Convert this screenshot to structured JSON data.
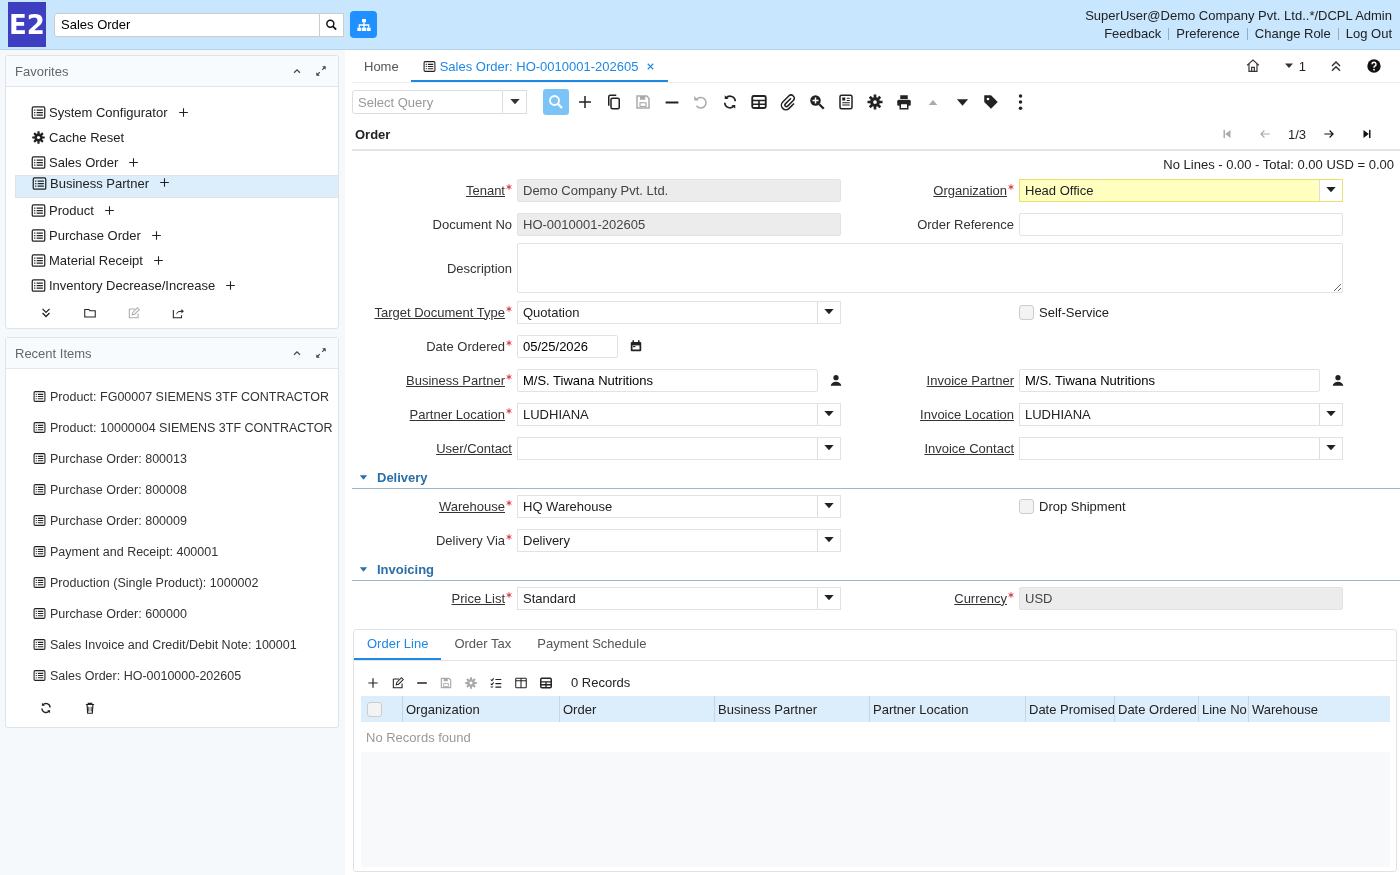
{
  "header": {
    "logo": "E2",
    "search": {
      "value": "Sales Order"
    },
    "user": "SuperUser@Demo Company Pvt. Ltd..*/DCPL Admin",
    "links": [
      "Feedback",
      "Preference",
      "Change Role",
      "Log Out"
    ]
  },
  "favorites": {
    "title": "Favorites",
    "items": [
      {
        "label": "System Configurator",
        "kind": "window",
        "addable": true,
        "selected": false
      },
      {
        "label": "Cache Reset",
        "kind": "process",
        "addable": false,
        "selected": false
      },
      {
        "label": "Sales Order",
        "kind": "window",
        "addable": true,
        "selected": false
      },
      {
        "label": "Business Partner",
        "kind": "window",
        "addable": true,
        "selected": true
      },
      {
        "label": "Product",
        "kind": "window",
        "addable": true,
        "selected": false
      },
      {
        "label": "Purchase Order",
        "kind": "window",
        "addable": true,
        "selected": false
      },
      {
        "label": "Material Receipt",
        "kind": "window",
        "addable": true,
        "selected": false
      },
      {
        "label": "Inventory Decrease/Increase",
        "kind": "window",
        "addable": true,
        "selected": false
      }
    ],
    "actions": [
      {
        "kind": "expand",
        "disabled": false
      },
      {
        "kind": "folder",
        "disabled": false
      },
      {
        "kind": "edit",
        "disabled": true
      },
      {
        "kind": "share",
        "disabled": false
      }
    ]
  },
  "recent": {
    "title": "Recent Items",
    "items": [
      "Product: FG00007 SIEMENS 3TF CONTRACTOR",
      "Product: 10000004 SIEMENS 3TF CONTRACTOR",
      "Purchase Order: 800013",
      "Purchase Order: 800008",
      "Purchase Order: 800009",
      "Payment and Receipt: 400001",
      "Production (Single Product): 1000002",
      "Purchase Order: 600000",
      "Sales Invoice and Credit/Debit Note: 100001",
      "Sales Order: HO-0010000-202605"
    ],
    "actions": [
      {
        "kind": "refresh",
        "disabled": false
      },
      {
        "kind": "trash",
        "disabled": false
      }
    ]
  },
  "tabs": [
    {
      "label": "Home",
      "selected": false,
      "closable": false
    },
    {
      "label": "Sales Order: HO-0010001-202605",
      "selected": true,
      "closable": true
    }
  ],
  "window_actions": {
    "badge": "1"
  },
  "toolbar": {
    "query_placeholder": "Select Query",
    "buttons": [
      {
        "kind": "search",
        "disabled": false,
        "active": true
      },
      {
        "kind": "plus",
        "disabled": false,
        "active": false
      },
      {
        "kind": "copy",
        "disabled": false,
        "active": false
      },
      {
        "kind": "save",
        "disabled": true,
        "active": false
      },
      {
        "kind": "minus",
        "disabled": false,
        "active": false
      },
      {
        "kind": "undo",
        "disabled": true,
        "active": false
      },
      {
        "kind": "refresh",
        "disabled": false,
        "active": false
      },
      {
        "kind": "grid",
        "disabled": false,
        "active": false
      },
      {
        "kind": "paperclip",
        "disabled": false,
        "active": false
      },
      {
        "kind": "zoom",
        "disabled": false,
        "active": false
      },
      {
        "kind": "report",
        "disabled": false,
        "active": false
      },
      {
        "kind": "gear",
        "disabled": false,
        "active": false
      },
      {
        "kind": "printer",
        "disabled": false,
        "active": false
      },
      {
        "kind": "up",
        "disabled": true,
        "active": false
      },
      {
        "kind": "down",
        "disabled": false,
        "active": false
      },
      {
        "kind": "tag",
        "disabled": false,
        "active": false
      },
      {
        "kind": "more",
        "disabled": false,
        "active": false
      }
    ]
  },
  "form": {
    "title": "Order",
    "record": "1/3",
    "nav": [
      {
        "kind": "first",
        "disabled": true
      },
      {
        "kind": "prev",
        "disabled": true
      },
      {
        "kind": "next",
        "disabled": false
      },
      {
        "kind": "last",
        "disabled": false
      }
    ],
    "summary": "No Lines - 0.00 - Total: 0.00 USD = 0.00",
    "groups": [
      {
        "rows": [
          [
            {
              "label": "Tenant",
              "link": true,
              "mandatory": true,
              "kind": "readonly",
              "value": "Demo Company Pvt. Ltd."
            },
            {
              "label": "Organization",
              "link": true,
              "mandatory": true,
              "kind": "select",
              "value": "Head Office",
              "focused": true
            }
          ],
          [
            {
              "label": "Document No",
              "link": false,
              "mandatory": false,
              "kind": "readonly",
              "value": "HO-0010001-202605"
            },
            {
              "label": "Order Reference",
              "link": false,
              "mandatory": false,
              "kind": "text"
            }
          ],
          [
            {
              "label": "Description",
              "link": false,
              "mandatory": false,
              "kind": "textarea"
            }
          ],
          [
            {
              "label": "Target Document Type",
              "link": true,
              "mandatory": true,
              "kind": "select",
              "value": "Quotation"
            },
            {
              "label": "Self-Service",
              "kind": "checkbox",
              "checked": false
            }
          ],
          [
            {
              "label": "Date Ordered",
              "link": false,
              "mandatory": true,
              "kind": "date",
              "value": "05/25/2026"
            }
          ],
          [
            {
              "label": "Business Partner",
              "link": true,
              "mandatory": true,
              "kind": "search",
              "value": "M/S. Tiwana Nutritions"
            },
            {
              "label": "Invoice Partner",
              "link": true,
              "mandatory": false,
              "kind": "search",
              "value": "M/S. Tiwana Nutritions"
            }
          ],
          [
            {
              "label": "Partner Location",
              "link": true,
              "mandatory": true,
              "kind": "select",
              "value": "LUDHIANA"
            },
            {
              "label": "Invoice Location",
              "link": true,
              "mandatory": false,
              "kind": "select",
              "value": "LUDHIANA"
            }
          ],
          [
            {
              "label": "User/Contact",
              "link": true,
              "mandatory": false,
              "kind": "select"
            },
            {
              "label": "Invoice Contact",
              "link": true,
              "mandatory": false,
              "kind": "select"
            }
          ]
        ]
      },
      {
        "title": "Delivery",
        "expanded": true,
        "rows": [
          [
            {
              "label": "Warehouse",
              "link": true,
              "mandatory": true,
              "kind": "select",
              "value": "HQ Warehouse"
            },
            {
              "label": "Drop Shipment",
              "kind": "checkbox",
              "checked": false
            }
          ],
          [
            {
              "label": "Delivery Via",
              "link": false,
              "mandatory": true,
              "kind": "select",
              "value": "Delivery"
            }
          ]
        ]
      },
      {
        "title": "Invoicing",
        "expanded": true,
        "rows": [
          [
            {
              "label": "Price List",
              "link": true,
              "mandatory": true,
              "kind": "select",
              "value": "Standard"
            },
            {
              "label": "Currency",
              "link": true,
              "mandatory": true,
              "kind": "readonly",
              "value": "USD"
            }
          ]
        ]
      }
    ]
  },
  "detail": {
    "tabs": [
      {
        "label": "Order Line",
        "selected": true
      },
      {
        "label": "Order Tax",
        "selected": false
      },
      {
        "label": "Payment Schedule",
        "selected": false
      }
    ],
    "buttons": [
      {
        "kind": "plus",
        "disabled": false
      },
      {
        "kind": "edit",
        "disabled": false
      },
      {
        "kind": "minus",
        "disabled": false
      },
      {
        "kind": "save",
        "disabled": true
      },
      {
        "kind": "gear",
        "disabled": true
      },
      {
        "kind": "checklist",
        "disabled": false
      },
      {
        "kind": "columns",
        "disabled": false
      },
      {
        "kind": "grid",
        "disabled": false
      }
    ],
    "records": "0 Records",
    "all_checked": false,
    "columns": [
      "Organization",
      "Order",
      "Business Partner",
      "Partner Location",
      "Date Promised",
      "Date Ordered",
      "Line No",
      "Warehouse"
    ],
    "empty": "No Records found"
  }
}
